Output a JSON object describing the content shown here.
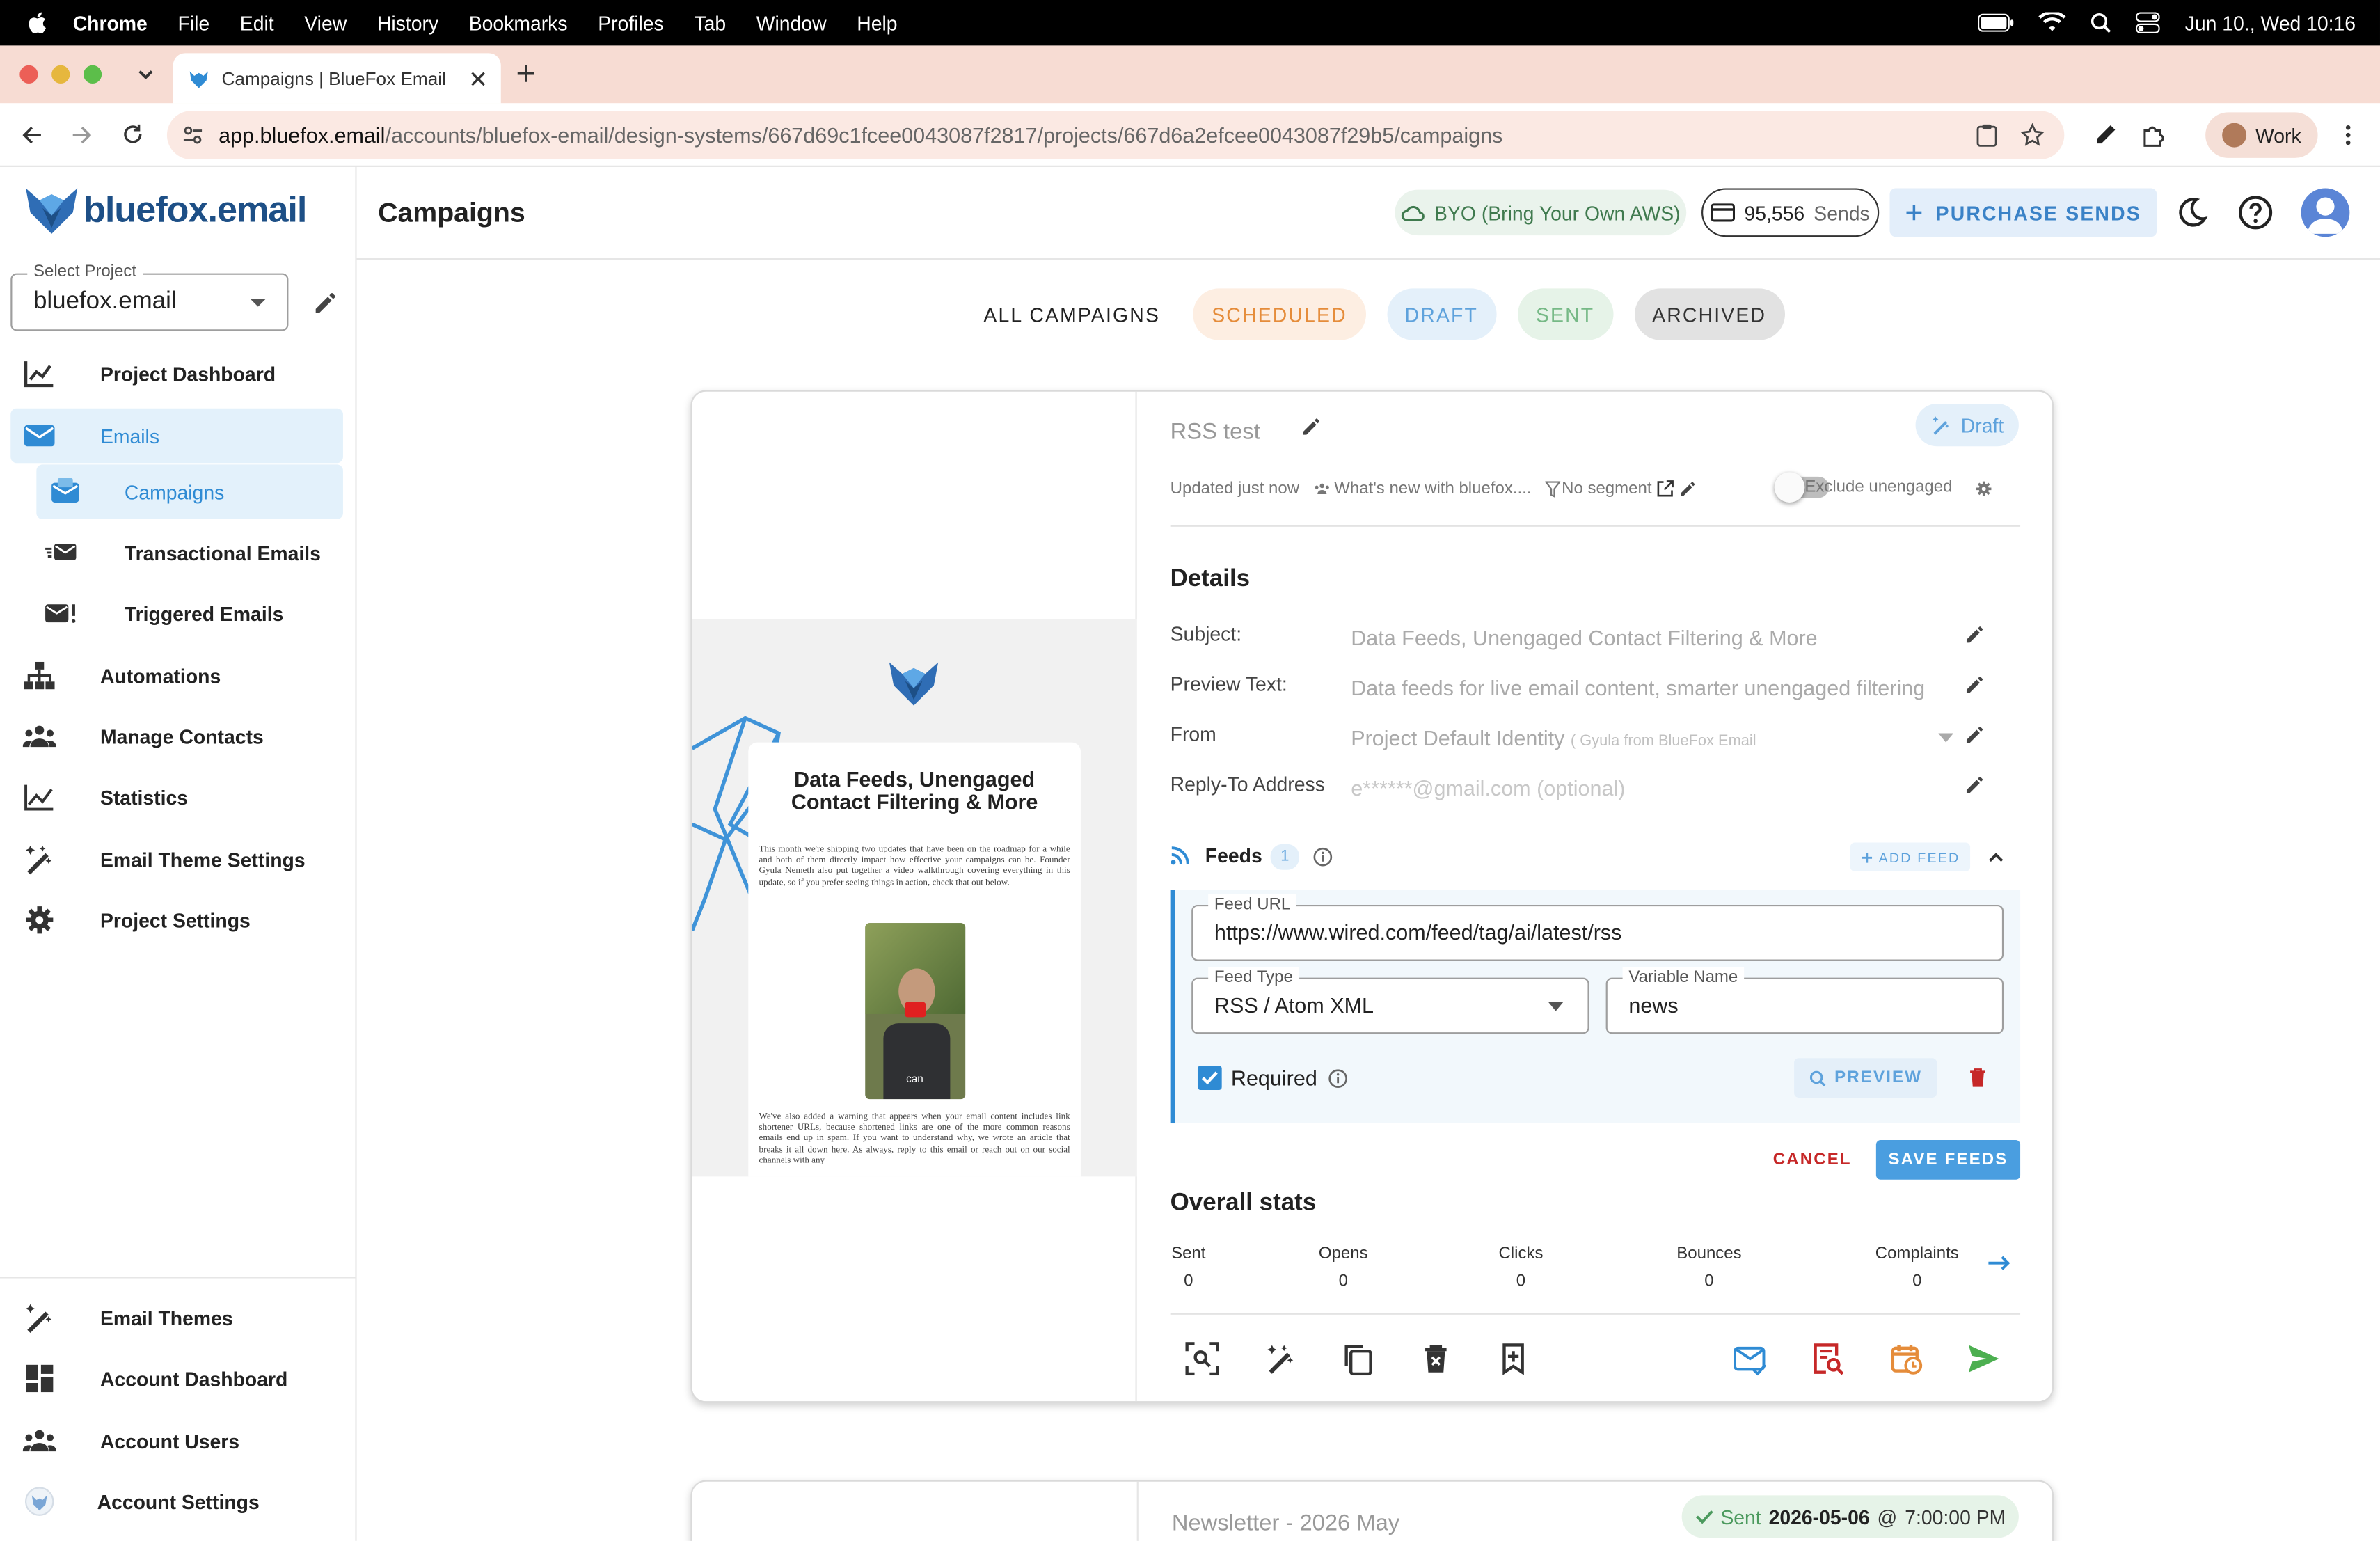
{
  "menubar": {
    "app": "Chrome",
    "items": [
      "File",
      "Edit",
      "View",
      "History",
      "Bookmarks",
      "Profiles",
      "Tab",
      "Window",
      "Help"
    ],
    "datetime": "Jun 10., Wed  10:16"
  },
  "browser": {
    "tab_title": "Campaigns | BlueFox Email",
    "url_host": "app.bluefox.email",
    "url_path": "/accounts/bluefox-email/design-systems/667d69c1fcee0043087f2817/projects/667d6a2efcee0043087f29b5/campaigns",
    "profile": "Work"
  },
  "sidebar": {
    "logo_text": "bluefox.email",
    "project_label": "Select Project",
    "project_value": "bluefox.email",
    "items": [
      {
        "label": "Project Dashboard",
        "icon": "chart-icon"
      },
      {
        "label": "Emails",
        "icon": "mail-icon"
      },
      {
        "label": "Campaigns",
        "icon": "campaign-icon"
      },
      {
        "label": "Transactional Emails",
        "icon": "fast-mail-icon"
      },
      {
        "label": "Triggered Emails",
        "icon": "mail-alert-icon"
      },
      {
        "label": "Automations",
        "icon": "sitemap-icon"
      },
      {
        "label": "Manage Contacts",
        "icon": "people-icon"
      },
      {
        "label": "Statistics",
        "icon": "line-chart-icon"
      },
      {
        "label": "Email Theme Settings",
        "icon": "magic-wand-icon"
      },
      {
        "label": "Project Settings",
        "icon": "gear-icon"
      }
    ],
    "bottom_items": [
      {
        "label": "Email Themes",
        "icon": "magic-wand-icon"
      },
      {
        "label": "Account Dashboard",
        "icon": "dashboard-icon"
      },
      {
        "label": "Account Users",
        "icon": "people-icon"
      },
      {
        "label": "Account Settings",
        "icon": "gear-icon"
      }
    ]
  },
  "header": {
    "title": "Campaigns",
    "byo": "BYO (Bring Your Own AWS)",
    "sends_count": "95,556",
    "sends_label": "Sends",
    "purchase": "PURCHASE SENDS"
  },
  "filters": [
    "ALL CAMPAIGNS",
    "SCHEDULED",
    "DRAFT",
    "SENT",
    "ARCHIVED"
  ],
  "campaign": {
    "name": "RSS test",
    "status": "Draft",
    "updated": "Updated just now",
    "audience": "What's new with bluefox....",
    "segment": "No segment",
    "exclude_label": "Exclude unengaged",
    "details_title": "Details",
    "subject_label": "Subject:",
    "subject_value": "Data Feeds, Unengaged Contact Filtering & More",
    "preview_label": "Preview Text:",
    "preview_value": "Data feeds for live email content, smarter unengaged filtering",
    "from_label": "From",
    "from_value": "Project Default Identity",
    "from_detail": "( Gyula from BlueFox Email < gyula@blue",
    "reply_label": "Reply-To Address",
    "reply_placeholder": "e******@gmail.com (optional)",
    "feeds_title": "Feeds",
    "feeds_count": "1",
    "add_feed": "ADD FEED",
    "feed_url_label": "Feed URL",
    "feed_url": "https://www.wired.com/feed/tag/ai/latest/rss",
    "feed_type_label": "Feed Type",
    "feed_type": "RSS / Atom XML",
    "var_label": "Variable Name",
    "var_value": "news",
    "required_label": "Required",
    "preview_btn": "PREVIEW",
    "cancel": "CANCEL",
    "save": "SAVE FEEDS",
    "stats_title": "Overall stats",
    "stats": [
      {
        "label": "Sent",
        "value": "0"
      },
      {
        "label": "Opens",
        "value": "0"
      },
      {
        "label": "Clicks",
        "value": "0"
      },
      {
        "label": "Bounces",
        "value": "0"
      },
      {
        "label": "Complaints",
        "value": "0"
      }
    ],
    "email_preview": {
      "headline": "Data Feeds, Unengaged Contact Filtering & More",
      "para1": "This month we're shipping two updates that have been on the roadmap for a while and both of them directly impact how effective your campaigns can be. Founder Gyula Nemeth also put together a video walkthrough covering everything in this update, so if you prefer seeing things in action, check that out below.",
      "caption": "can",
      "para2": "We've also added a warning that appears when your email content includes link shortener URLs, because shortened links are one of the more common reasons emails end up in spam. If you want to understand why, we wrote an article that breaks it all down here. As always, reply to this email or reach out on our social channels with any"
    }
  },
  "campaign2": {
    "name": "Newsletter - 2026 May",
    "status": "Sent",
    "date": "2026-05-06",
    "at": "@",
    "time": "7:00:00 PM"
  },
  "colors": {
    "accent": "#2f8bd4",
    "brand": "#1d4f86",
    "danger": "#c62828",
    "success": "#4c9a5e",
    "warning": "#e58c3a"
  }
}
